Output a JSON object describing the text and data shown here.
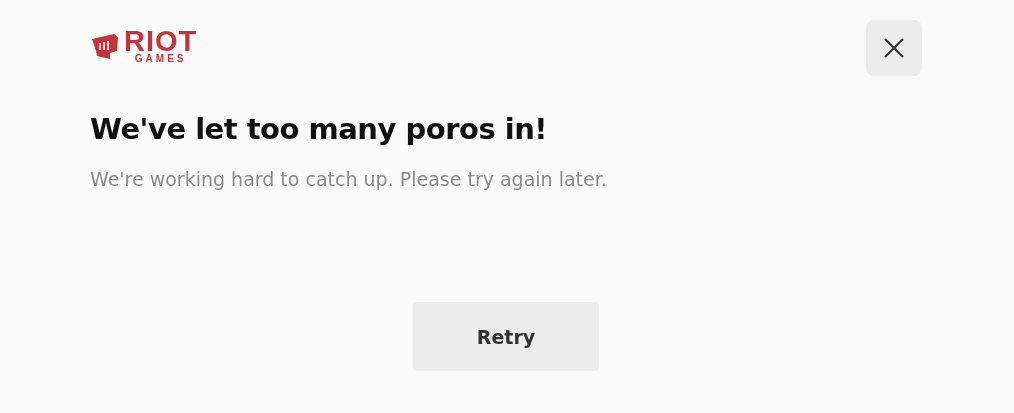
{
  "logo": {
    "word": "RIOT",
    "subword": "GAMES"
  },
  "title": "We've let too many poros in!",
  "message": "We're working hard to catch up. Please try again later.",
  "retry_button": "Retry"
}
